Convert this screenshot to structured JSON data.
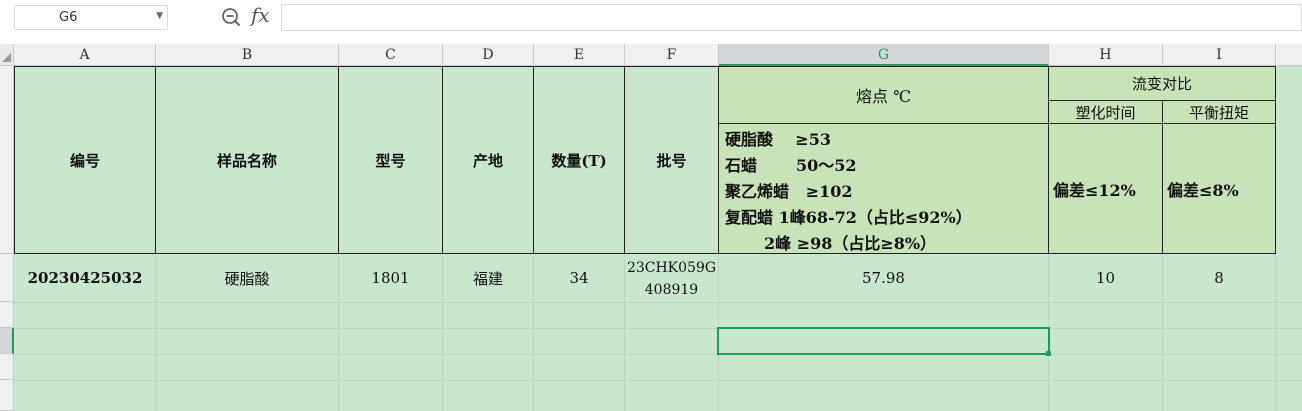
{
  "formula_bar": {
    "name_box": "G6",
    "fx_label": "fx",
    "formula_value": ""
  },
  "column_headers": [
    "A",
    "B",
    "C",
    "D",
    "E",
    "F",
    "G",
    "H",
    "I"
  ],
  "header_row": {
    "col_a": "编号",
    "col_b": "样品名称",
    "col_c": "型号",
    "col_d": "产地",
    "col_e": "数量(T)",
    "col_f": "批号",
    "col_g_title": "熔点 ℃",
    "col_g_spec": [
      "硬脂酸    ≥53",
      "石蜡       50～52",
      "聚乙烯蜡   ≥102",
      "复配蜡 1峰68-72（占比≤92%）",
      "       2峰 ≥98（占比≥8%）"
    ],
    "rheology_title": "流变对比",
    "col_h_title": "塑化时间",
    "col_i_title": "平衡扭矩",
    "col_h_spec": "偏差≤12%",
    "col_i_spec": "偏差≤8%"
  },
  "data_row": {
    "id": "20230425032",
    "sample_name": "硬脂酸",
    "model": "1801",
    "origin": "福建",
    "quantity": "34",
    "batch_line1": "23CHK059G",
    "batch_line2": "408919",
    "melting_point": "57.98",
    "plasticizing_time": "10",
    "balance_torque": "8"
  },
  "colors": {
    "sheet_background": "#c9e7cd",
    "highlight_fill": "#c8e3b8",
    "selection": "#1d9b5a"
  }
}
